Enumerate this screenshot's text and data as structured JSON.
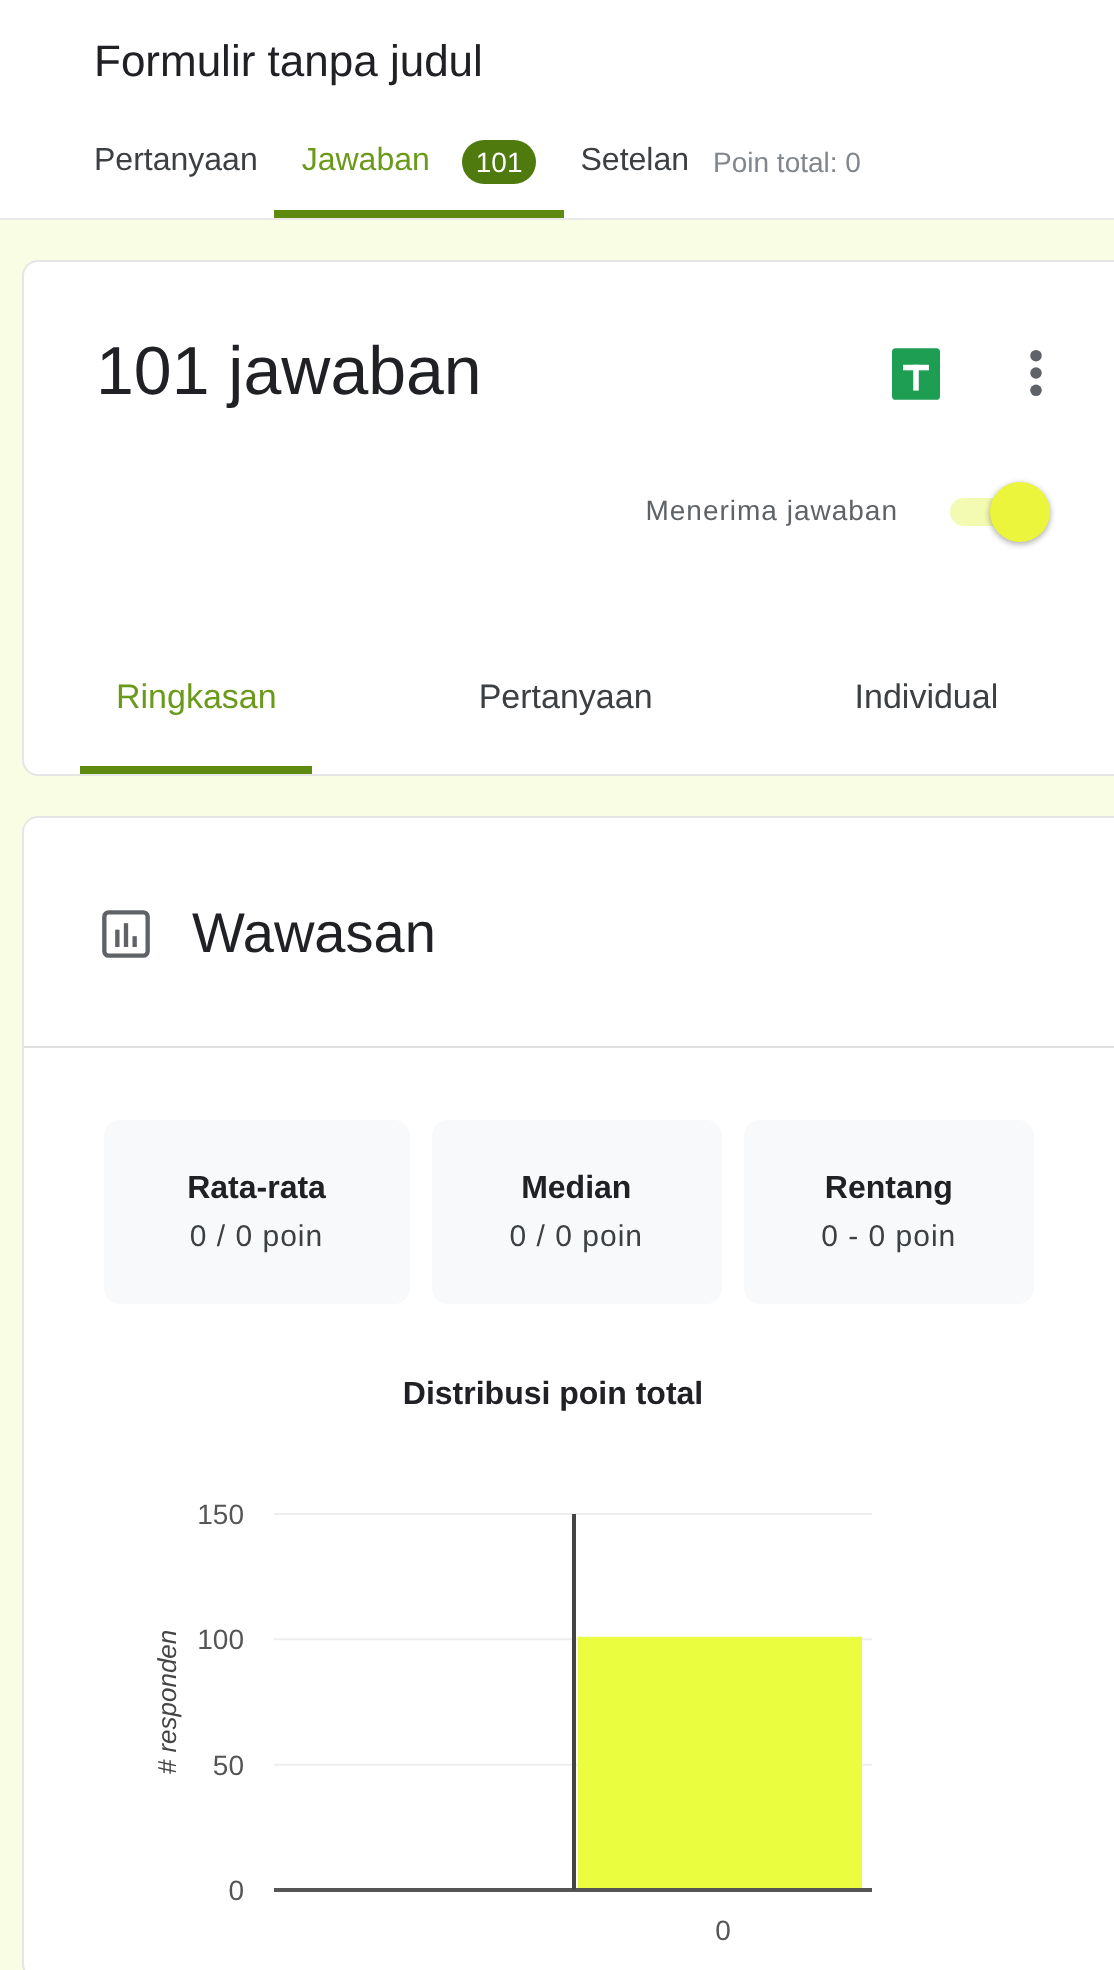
{
  "form_title": "Formulir tanpa judul",
  "tabs": [
    {
      "label": "Pertanyaan",
      "selected": false
    },
    {
      "label": "Jawaban",
      "selected": true,
      "badge": "101"
    },
    {
      "label": "Setelan",
      "selected": false
    }
  ],
  "total_points": "Poin total: 0",
  "responses_card": {
    "title": "101 jawaban",
    "accepting_label": "Menerima jawaban",
    "accepting": true,
    "subtabs": [
      {
        "label": "Ringkasan",
        "selected": true
      },
      {
        "label": "Pertanyaan",
        "selected": false
      },
      {
        "label": "Individual",
        "selected": false
      }
    ]
  },
  "insights": {
    "title": "Wawasan",
    "stats": [
      {
        "label": "Rata-rata",
        "value": "0 / 0 poin"
      },
      {
        "label": "Median",
        "value": "0 / 0 poin"
      },
      {
        "label": "Rentang",
        "value": "0 - 0 poin"
      }
    ],
    "chart_data": {
      "type": "bar",
      "title": "Distribusi poin total",
      "ylabel": "# responden",
      "categories": [
        "0"
      ],
      "series": [
        {
          "color": "#ebfd3f",
          "values": [
            101
          ]
        }
      ],
      "ylim": [
        0,
        150
      ],
      "yticks": [
        0,
        50,
        100,
        150
      ]
    }
  }
}
